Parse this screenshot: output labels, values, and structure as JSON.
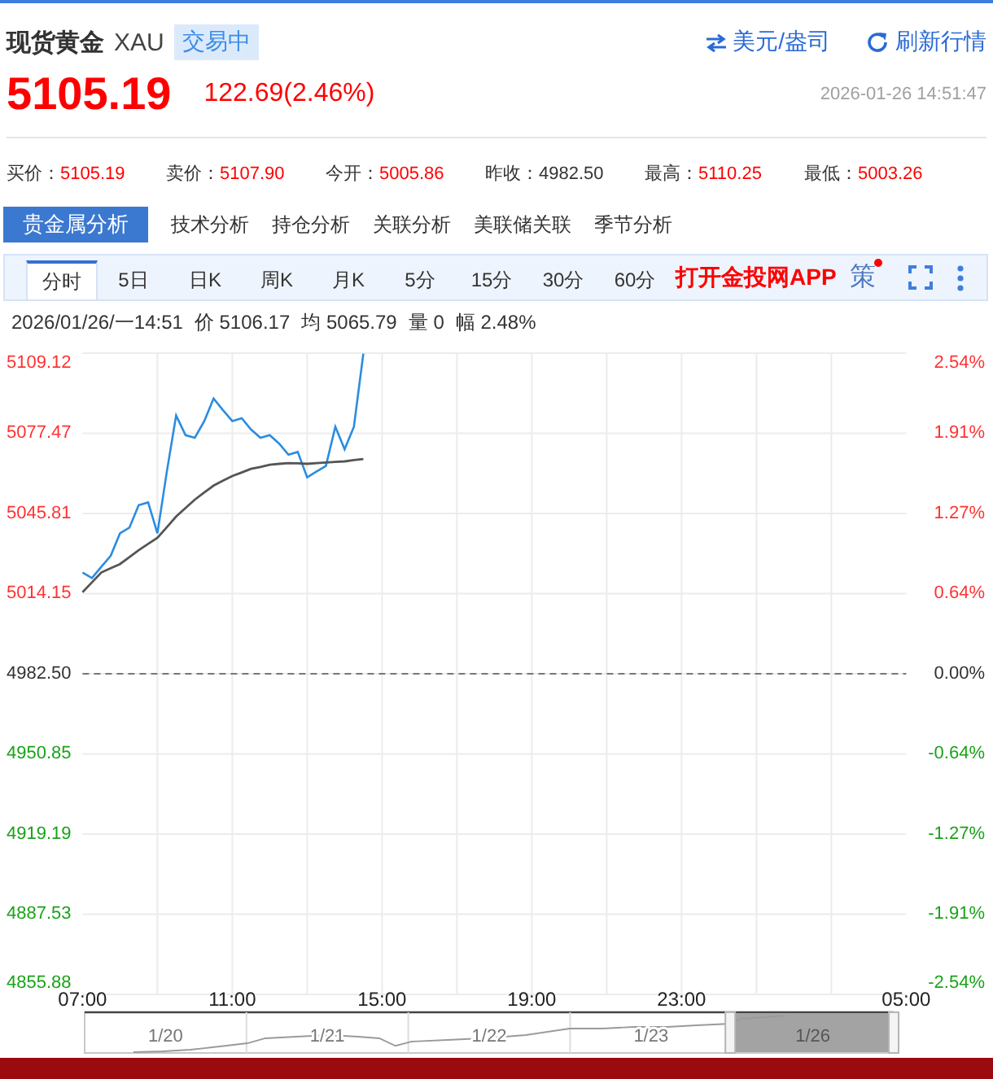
{
  "header": {
    "title": "现货黄金",
    "symbol": "XAU",
    "status": "交易中",
    "unit_button": "美元/盎司",
    "refresh_button": "刷新行情"
  },
  "quote": {
    "price": "5105.19",
    "change": "122.69(2.46%)",
    "color": "#ff0000",
    "timestamp": "2026-01-26 14:51:47"
  },
  "stats": [
    {
      "label": "买价：",
      "value": "5105.19",
      "color": "#ff0000"
    },
    {
      "label": "卖价：",
      "value": "5107.90",
      "color": "#ff0000"
    },
    {
      "label": "今开：",
      "value": "5005.86",
      "color": "#ff0000"
    },
    {
      "label": "昨收：",
      "value": "4982.50",
      "color": "#333333"
    },
    {
      "label": "最高：",
      "value": "5110.25",
      "color": "#ff0000"
    },
    {
      "label": "最低：",
      "value": "5003.26",
      "color": "#ff0000"
    }
  ],
  "analysis_tabs": [
    {
      "label": "贵金属分析",
      "selected": true
    },
    {
      "label": "技术分析",
      "selected": false
    },
    {
      "label": "持仓分析",
      "selected": false
    },
    {
      "label": "关联分析",
      "selected": false
    },
    {
      "label": "美联储关联",
      "selected": false
    },
    {
      "label": "季节分析",
      "selected": false
    }
  ],
  "toolbar": {
    "periods": [
      {
        "label": "分时",
        "selected": true
      },
      {
        "label": "5日",
        "selected": false
      },
      {
        "label": "日K",
        "selected": false
      },
      {
        "label": "周K",
        "selected": false
      },
      {
        "label": "月K",
        "selected": false
      },
      {
        "label": "5分",
        "selected": false
      },
      {
        "label": "15分",
        "selected": false
      },
      {
        "label": "30分",
        "selected": false
      },
      {
        "label": "60分",
        "selected": false
      }
    ],
    "app_link": "打开金投网APP",
    "strategy": {
      "label": "策",
      "dot": true
    }
  },
  "info": {
    "time": "2026/01/26/一14:51",
    "items": [
      {
        "label": "价",
        "value": "5106.17"
      },
      {
        "label": "均",
        "value": "5065.79"
      },
      {
        "label": "量",
        "value": "0"
      },
      {
        "label": "幅",
        "value": "2.48%"
      }
    ]
  },
  "chart": {
    "right_axis": [
      "2.54%",
      "1.91%",
      "1.27%",
      "0.64%",
      "0.00%",
      "-0.64%",
      "-1.27%",
      "-1.91%",
      "-2.54%"
    ],
    "chart_data": {
      "type": "line",
      "categories": [
        "07:00",
        null,
        null,
        null,
        null,
        null,
        null,
        null,
        null,
        null,
        null,
        null,
        null,
        null,
        null,
        null,
        "11:00",
        null,
        null,
        null,
        null,
        null,
        null,
        null,
        null,
        null,
        null,
        null,
        null,
        null,
        null,
        null,
        "15:00",
        null,
        null,
        null,
        null,
        null,
        null,
        null,
        null,
        null,
        null,
        null,
        null,
        null,
        null,
        null,
        "19:00",
        null,
        null,
        null,
        null,
        null,
        null,
        null,
        null,
        null,
        null,
        null,
        null,
        null,
        null,
        null,
        "23:00",
        null,
        null,
        null,
        null,
        null,
        null,
        null,
        null,
        null,
        null,
        null,
        null,
        null,
        null,
        null,
        null,
        null,
        null,
        null,
        null,
        null,
        null,
        null,
        "05:00"
      ],
      "series": [
        {
          "color": "#2b8ce0",
          "values": [
            5022.5,
            5020.3,
            5024.7,
            5029.1,
            5038.0,
            5040.2,
            5049.1,
            5050.2,
            5038.0,
            5062.4,
            5084.5,
            5076.7,
            5075.7,
            5082.3,
            5091.2,
            5086.7,
            5082.3,
            5083.4,
            5079.0,
            5075.7,
            5076.7,
            5073.4,
            5069.0,
            5070.1,
            5060.1,
            5062.4,
            5064.6,
            5080.1,
            5071.2,
            5080.1,
            5108.9,
            null,
            null,
            null,
            null,
            null,
            null,
            null,
            null,
            null,
            null,
            null,
            null,
            null,
            null,
            null,
            null,
            null,
            null,
            null,
            null,
            null,
            null,
            null,
            null,
            null,
            null,
            null,
            null,
            null,
            null,
            null,
            null,
            null,
            null,
            null,
            null,
            null,
            null,
            null,
            null,
            null,
            null,
            null,
            null,
            null,
            null,
            null,
            null,
            null,
            null,
            null,
            null,
            null,
            null,
            null,
            null,
            null,
            null
          ]
        },
        {
          "color": "#555555",
          "values": [
            5014.7,
            5018.6,
            5022.5,
            5024.2,
            5025.8,
            5028.6,
            5031.3,
            5033.8,
            5036.2,
            5040.4,
            5044.6,
            5048.0,
            5051.3,
            5054.1,
            5056.8,
            5058.7,
            5060.6,
            5062.0,
            5063.4,
            5064.2,
            5065.0,
            5065.4,
            5065.7,
            5065.6,
            5065.4,
            5065.7,
            5065.9,
            5066.2,
            5066.4,
            5066.9,
            5067.3,
            null,
            null,
            null,
            null,
            null,
            null,
            null,
            null,
            null,
            null,
            null,
            null,
            null,
            null,
            null,
            null,
            null,
            null,
            null,
            null,
            null,
            null,
            null,
            null,
            null,
            null,
            null,
            null,
            null,
            null,
            null,
            null,
            null,
            null,
            null,
            null,
            null,
            null,
            null,
            null,
            null,
            null,
            null,
            null,
            null,
            null,
            null,
            null,
            null,
            null,
            null,
            null,
            null,
            null,
            null,
            null,
            null,
            null
          ]
        }
      ],
      "ylim": [
        4855.88,
        5109.12
      ],
      "yticks": [
        {
          "value": 5109.12,
          "label": "5109.12"
        },
        {
          "value": 5077.47,
          "label": "5077.47"
        },
        {
          "value": 5045.81,
          "label": "5045.81"
        },
        {
          "value": 5014.15,
          "label": "5014.15"
        },
        {
          "value": 4982.5,
          "label": "4982.50"
        },
        {
          "value": 4950.85,
          "label": "4950.85"
        },
        {
          "value": 4919.19,
          "label": "4919.19"
        },
        {
          "value": 4887.53,
          "label": "4887.53"
        },
        {
          "value": 4855.88,
          "label": "4855.88"
        }
      ],
      "grid": true,
      "ref_lines": [
        {
          "axis": "y",
          "value": 4982.5
        }
      ]
    }
  },
  "navigator": {
    "days": [
      {
        "label": "1/20",
        "selected": false
      },
      {
        "label": "1/21",
        "selected": false
      },
      {
        "label": "1/22",
        "selected": false
      },
      {
        "label": "1/23",
        "selected": false
      },
      {
        "label": "1/26",
        "selected": true
      }
    ]
  }
}
